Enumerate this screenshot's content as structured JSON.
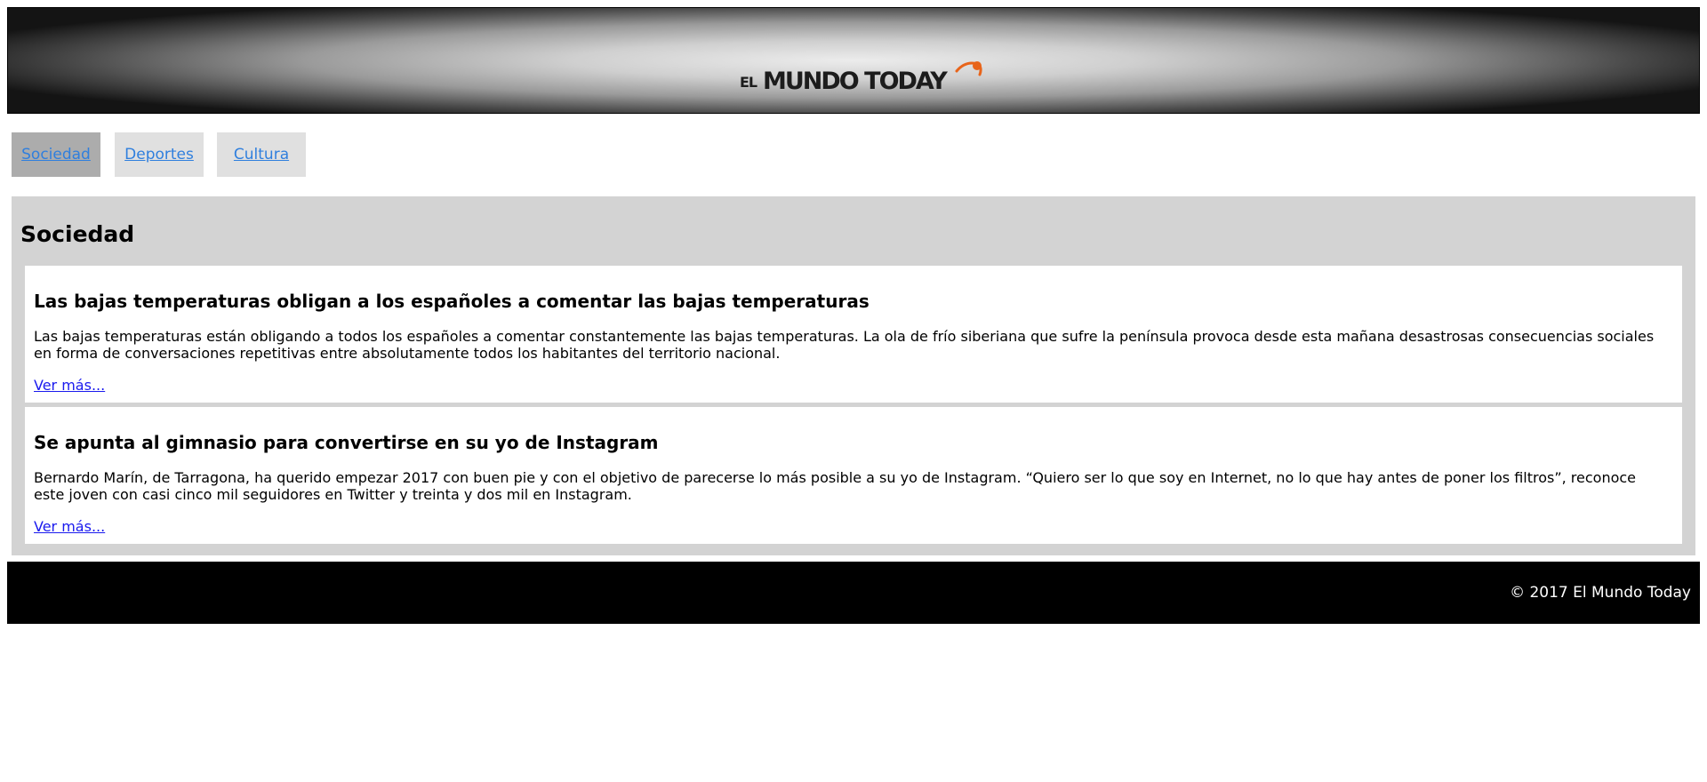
{
  "header": {
    "logo": {
      "prefix": "EL",
      "main": "MUNDO TODAY",
      "accent_color": "#e8641a"
    }
  },
  "tabs": [
    {
      "label": "Sociedad",
      "active": true
    },
    {
      "label": "Deportes",
      "active": false
    },
    {
      "label": "Cultura",
      "active": false
    }
  ],
  "section": {
    "title": "Sociedad",
    "articles": [
      {
        "title": "Las bajas temperaturas obligan a los españoles a comentar las bajas temperaturas",
        "body": "Las bajas temperaturas están obligando a todos los españoles a comentar constantemente las bajas temperaturas. La ola de frío siberiana que sufre la península provoca desde esta mañana desastrosas consecuencias sociales en forma de conversaciones repetitivas entre absolutamente todos los habitantes del territorio nacional.",
        "link": "Ver más..."
      },
      {
        "title": "Se apunta al gimnasio para convertirse en su yo de Instagram",
        "body": "Bernardo Marín, de Tarragona, ha querido empezar 2017 con buen pie y con el objetivo de parecerse lo más posible a su yo de Instagram. “Quiero ser lo que soy en Internet, no lo que hay antes de poner los filtros”, reconoce este joven con casi cinco mil seguidores en Twitter y treinta y dos mil en Instagram.",
        "link": "Ver más..."
      }
    ]
  },
  "footer": {
    "copyright": "© 2017 El Mundo Today"
  }
}
